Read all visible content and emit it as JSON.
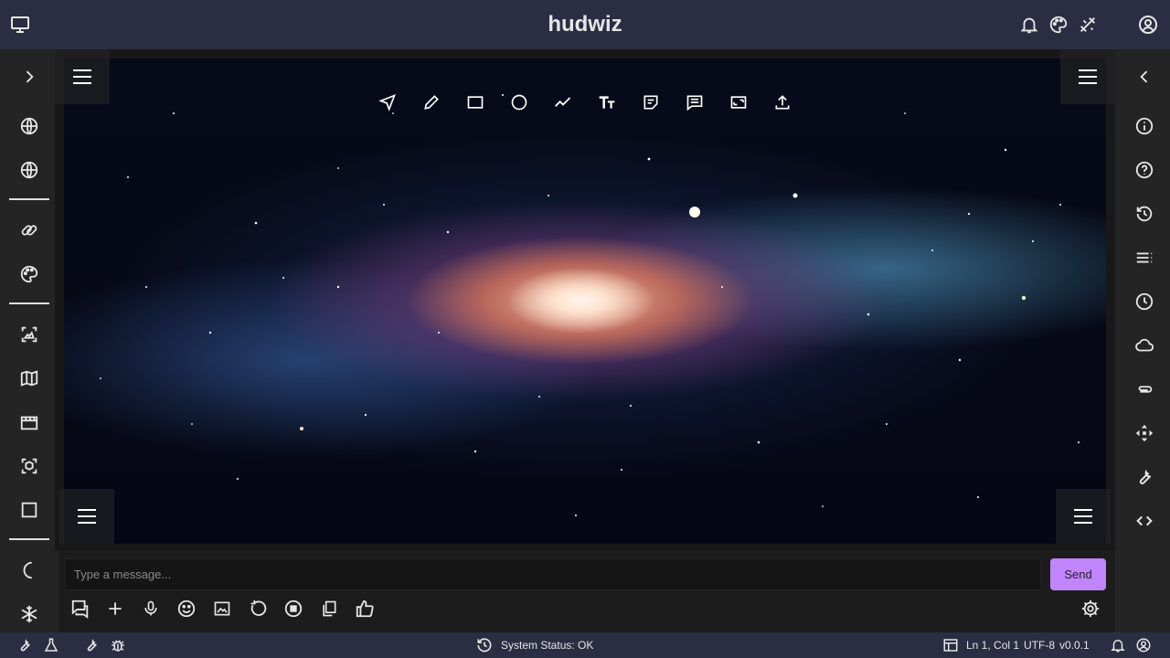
{
  "app": {
    "title": "hudwiz"
  },
  "header": {
    "icons": [
      "monitor-icon",
      "bell-icon",
      "palette-icon",
      "tools-icon",
      "account-icon"
    ]
  },
  "canvas": {
    "image": "spiral galaxy",
    "toolbar": [
      "select-arrow-icon",
      "pencil-icon",
      "rectangle-icon",
      "circle-icon",
      "polyline-icon",
      "text-icon",
      "sticky-note-icon",
      "comment-icon",
      "image-frame-icon",
      "upload-icon"
    ],
    "corner_menus": [
      "top-left",
      "top-right",
      "bottom-left",
      "bottom-right"
    ]
  },
  "chat": {
    "placeholder": "Type a message...",
    "send_label": "Send"
  },
  "status": {
    "system": "System Status: OK",
    "cursor": "Ln 1, Col 1",
    "encoding": "UTF-8",
    "version": "v0.0.1"
  },
  "colors": {
    "header_bg": "#2b2d42",
    "accent": "#c084fc",
    "sidebar_bg": "#242424"
  }
}
